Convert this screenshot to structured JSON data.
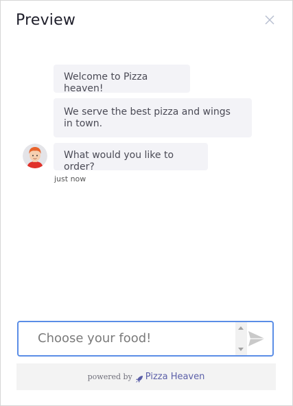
{
  "header": {
    "title": "Preview",
    "close_icon": "close-icon"
  },
  "chat": {
    "messages": [
      {
        "text": "Welcome to Pizza heaven!"
      },
      {
        "text": "We serve the best pizza and wings in town."
      },
      {
        "text": "What would you like to order?"
      }
    ],
    "timestamp": "just now",
    "avatar_icon": "bot-avatar-icon"
  },
  "composer": {
    "placeholder": "Choose your food!",
    "value": "",
    "send_icon": "send-icon"
  },
  "footer": {
    "powered_by": "powered by",
    "brand": "Pizza Heaven",
    "brand_icon": "rocket-icon"
  },
  "colors": {
    "bubble_bg": "#f3f3f7",
    "input_border": "#5a8de6",
    "brand": "#5b5fa8",
    "footer_bg": "#f3f3f3"
  }
}
